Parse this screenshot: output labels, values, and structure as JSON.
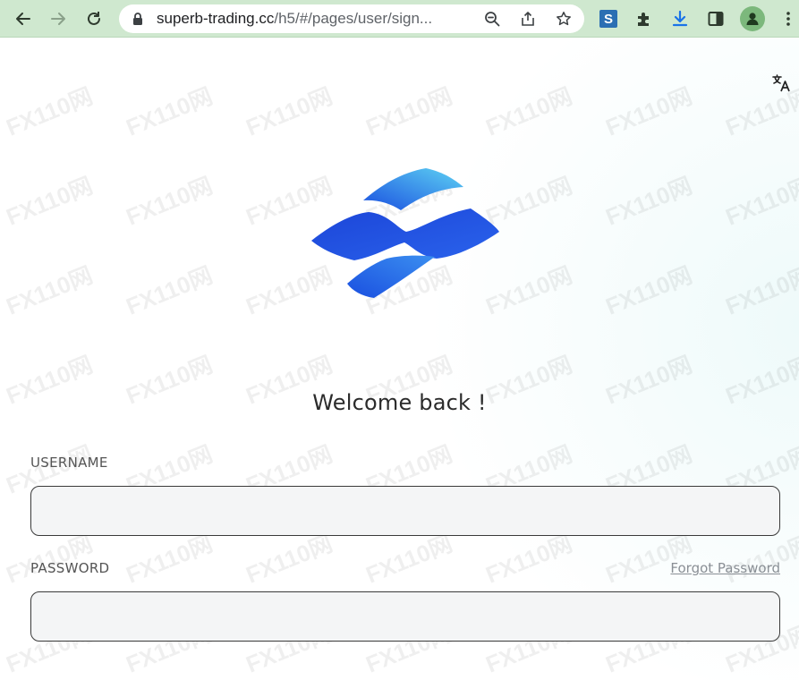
{
  "browser": {
    "url_host": "superb-trading.cc",
    "url_path": "/h5/#/pages/user/sign..."
  },
  "page": {
    "welcome": "Welcome back !",
    "username_label": "USERNAME",
    "username_value": "",
    "password_label": "PASSWORD",
    "password_value": "",
    "forgot_password": "Forgot Password",
    "watermark": "FX110网"
  },
  "colors": {
    "toolbar_bg": "#cfe8cf",
    "logo_blue": "#1a4fe0",
    "logo_cyan": "#4fc9f0",
    "input_border": "#3a3a3a",
    "link": "#8a8f95"
  },
  "icons": {
    "back": "back-arrow-icon",
    "forward": "forward-arrow-icon",
    "reload": "reload-icon",
    "lock": "lock-icon",
    "zoom": "zoom-icon",
    "share": "share-icon",
    "bookmark": "star-icon",
    "ext_s": "s-extension-icon",
    "extensions": "puzzle-icon",
    "download": "download-icon",
    "side_panel": "side-panel-icon",
    "profile": "profile-avatar-icon",
    "menu": "kebab-menu-icon",
    "translate": "translate-icon"
  }
}
